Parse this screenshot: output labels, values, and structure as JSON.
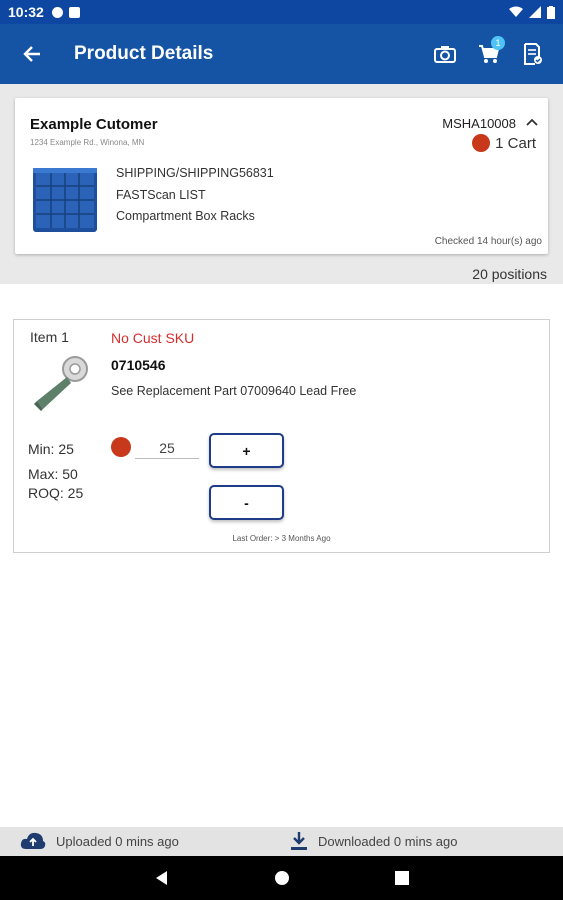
{
  "status_bar": {
    "time": "10:32"
  },
  "appbar": {
    "title": "Product Details",
    "cart_badge": "1"
  },
  "customer": {
    "name": "Example Cutomer",
    "address": "1234 Example Rd., Winona, MN",
    "account": "MSHA10008",
    "cart_label": "1 Cart",
    "lines": [
      "SHIPPING/SHIPPING56831",
      "FASTScan LIST",
      "Compartment Box Racks"
    ],
    "checked": "Checked 14 hour(s) ago"
  },
  "positions": "20 positions",
  "item": {
    "label": "Item 1",
    "sku_status": "No Cust SKU",
    "part_number": "0710546",
    "description": "See Replacement Part 07009640 Lead Free",
    "min": "Min: 25",
    "max": "Max: 50",
    "roq": "ROQ: 25",
    "quantity": "25",
    "plus_label": "+",
    "minus_label": "-",
    "last_order": "Last Order: > 3 Months Ago"
  },
  "footer": {
    "uploaded": "Uploaded 0 mins ago",
    "downloaded": "Downloaded 0 mins ago"
  },
  "colors": {
    "appbar": "#1554a5",
    "status": "#c8391b",
    "alert_text": "#d32f2f"
  },
  "icons": [
    "back-arrow-icon",
    "camera-icon",
    "cart-icon",
    "document-check-icon",
    "chevron-up-icon",
    "cloud-upload-icon",
    "download-icon"
  ]
}
